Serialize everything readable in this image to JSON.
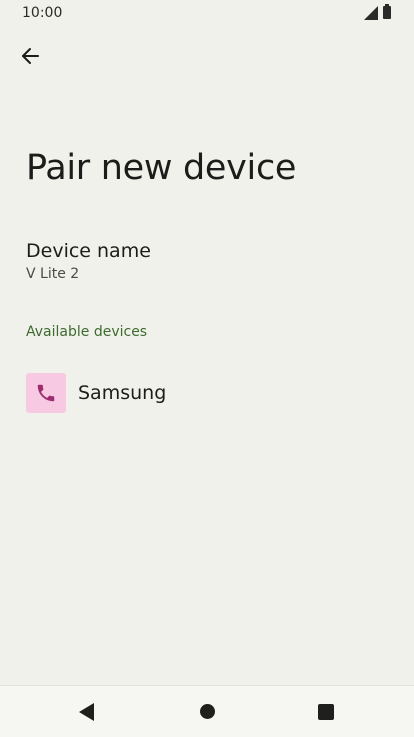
{
  "status_bar": {
    "time": "10:00"
  },
  "header": {
    "back_icon": "arrow-back-icon",
    "title": "Pair new device"
  },
  "device_name": {
    "label": "Device name",
    "value": "V Lite 2"
  },
  "available_devices": {
    "header": "Available devices",
    "items": [
      {
        "label": "Samsung",
        "icon": "phone-icon"
      }
    ]
  },
  "colors": {
    "background": "#f1f1ec",
    "section_header": "#3d6b2f",
    "device_icon_bg": "#f7c9e3",
    "device_icon_fg": "#9c2e6f"
  },
  "nav_bar": {
    "icons": [
      "nav-back-icon",
      "nav-home-icon",
      "nav-recents-icon"
    ]
  }
}
